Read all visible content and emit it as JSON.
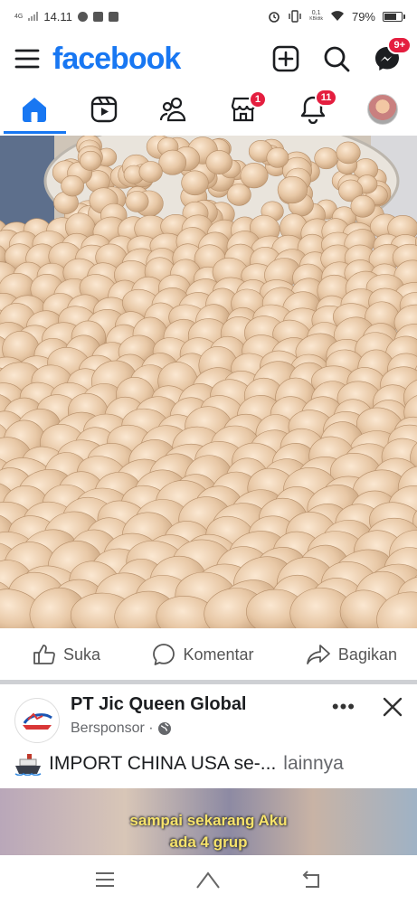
{
  "status_bar": {
    "network": "4G",
    "time": "14.11",
    "data_speed_value": "0,1",
    "data_speed_unit": "KB/dtk",
    "battery": "79%",
    "battery_level": 0.79
  },
  "header": {
    "logo": "facebook",
    "messenger_badge": "9+",
    "icons": [
      "menu-icon",
      "create-post-icon",
      "search-icon",
      "messenger-icon"
    ]
  },
  "nav": {
    "tabs": [
      {
        "name": "home",
        "icon": "home-icon",
        "active": true,
        "badge": ""
      },
      {
        "name": "reels",
        "icon": "reels-icon",
        "active": false,
        "badge": ""
      },
      {
        "name": "friends",
        "icon": "friends-icon",
        "active": false,
        "badge": ""
      },
      {
        "name": "marketplace",
        "icon": "marketplace-icon",
        "active": false,
        "badge": "1"
      },
      {
        "name": "notifications",
        "icon": "bell-icon",
        "active": false,
        "badge": "11"
      },
      {
        "name": "profile",
        "icon": "avatar",
        "active": false,
        "badge": ""
      }
    ]
  },
  "post": {
    "actions": {
      "like": "Suka",
      "comment": "Komentar",
      "share": "Bagikan"
    }
  },
  "sponsored": {
    "page_name": "PT Jic Queen Global",
    "subtitle": "Bersponsor ·",
    "text": "IMPORT CHINA USA se-...",
    "more": "lainnya",
    "image_caption_line1": "sampai sekarang Aku",
    "image_caption_line2": "ada 4 grup"
  },
  "colors": {
    "brand": "#1877f2",
    "badge": "#e41e3f",
    "muted": "#65676b"
  }
}
